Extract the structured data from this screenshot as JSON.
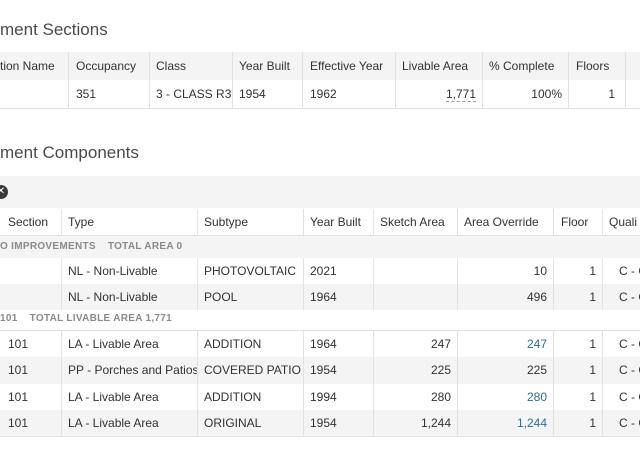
{
  "sections_title": "ment Sections",
  "sections_table": {
    "columns": [
      "tion Name",
      "Occupancy",
      "Class",
      "Year Built",
      "Effective Year",
      "Livable Area",
      "% Complete",
      "Floors"
    ],
    "row": {
      "name": "",
      "occupancy": "351",
      "class": "3 - CLASS R3",
      "year_built": "1954",
      "effective_year": "1962",
      "livable_area": "1,771",
      "complete": "100%",
      "floors": "1"
    }
  },
  "components_title": "ment Components",
  "clear_icon": "clear-icon",
  "components_table": {
    "columns": [
      "Section",
      "Type",
      "Subtype",
      "Year Built",
      "Sketch Area",
      "Area Override",
      "Floor",
      "Quali"
    ],
    "group1": {
      "label": "O IMPROVEMENTS",
      "total": "TOTAL AREA 0"
    },
    "group1_rows": [
      {
        "section": "",
        "type": "NL - Non-Livable",
        "subtype": "PHOTOVOLTAIC",
        "year": "2021",
        "sketch": "",
        "override": "10",
        "floor": "1",
        "quality": "C - Co"
      },
      {
        "section": "",
        "type": "NL - Non-Livable",
        "subtype": "POOL",
        "year": "1964",
        "sketch": "",
        "override": "496",
        "floor": "1",
        "quality": "C - Co"
      }
    ],
    "group2": {
      "label": "101",
      "total": "TOTAL LIVABLE AREA 1,771"
    },
    "group2_rows": [
      {
        "section": "101",
        "type": "LA - Livable Area",
        "subtype": "ADDITION",
        "year": "1964",
        "sketch": "247",
        "override": "247",
        "floor": "1",
        "quality": "C - Co"
      },
      {
        "section": "101",
        "type": "PP - Porches and Patios",
        "subtype": "COVERED PATIO",
        "year": "1954",
        "sketch": "225",
        "override": "225",
        "floor": "1",
        "quality": "C - Co"
      },
      {
        "section": "101",
        "type": "LA - Livable Area",
        "subtype": "ADDITION",
        "year": "1994",
        "sketch": "280",
        "override": "280",
        "floor": "1",
        "quality": "C - Co"
      },
      {
        "section": "101",
        "type": "LA - Livable Area",
        "subtype": "ORIGINAL",
        "year": "1954",
        "sketch": "1,244",
        "override": "1,244",
        "floor": "1",
        "quality": "C - Co"
      }
    ]
  },
  "colors": {
    "link": "#2a6e97",
    "row_alt": "#f4f4f4",
    "group_text": "#8a8a8a"
  }
}
